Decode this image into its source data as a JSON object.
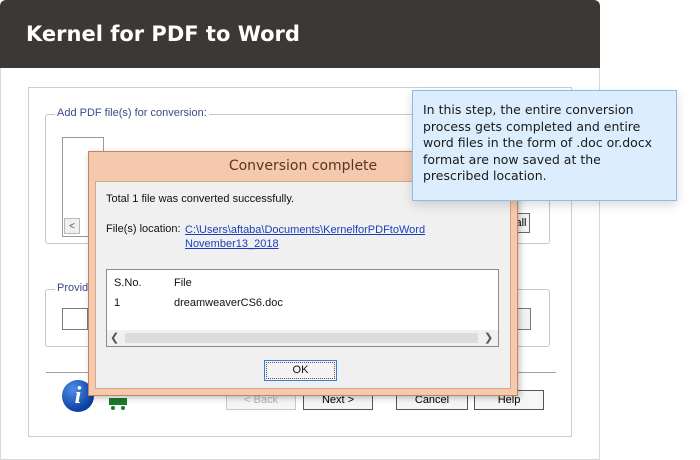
{
  "header": {
    "title": "Kernel for PDF to Word"
  },
  "main": {
    "add_group_label": "Add PDF file(s) for conversion:",
    "remove_all_fragment": "all",
    "provide_group_label": "Provid",
    "scroll_left_glyph": "<"
  },
  "wizard_buttons": {
    "back": "< Back",
    "next": "Next >",
    "cancel": "Cancel",
    "help": "Help"
  },
  "dialog": {
    "title": "Conversion complete",
    "message": "Total 1 file was converted successfully.",
    "location_label": "File(s) location:",
    "location_path": "C:\\Users\\aftaba\\Documents\\KernelforPDFtoWord November13_2018",
    "table": {
      "headers": [
        "S.No.",
        "File"
      ],
      "rows": [
        [
          "1",
          "dreamweaverCS6.doc"
        ]
      ]
    },
    "ok_label": "OK"
  },
  "callout": {
    "text": "In this step, the entire conversion process gets completed and entire word files in the form of .doc or.docx format are now saved at the prescribed location."
  },
  "icons": {
    "info": "info-icon",
    "cart": "cart-icon"
  },
  "colors": {
    "header_bg": "#3c3836",
    "dialog_frame": "#f5c9ae",
    "callout_bg": "#dceefe",
    "link": "#1a3fbd"
  }
}
